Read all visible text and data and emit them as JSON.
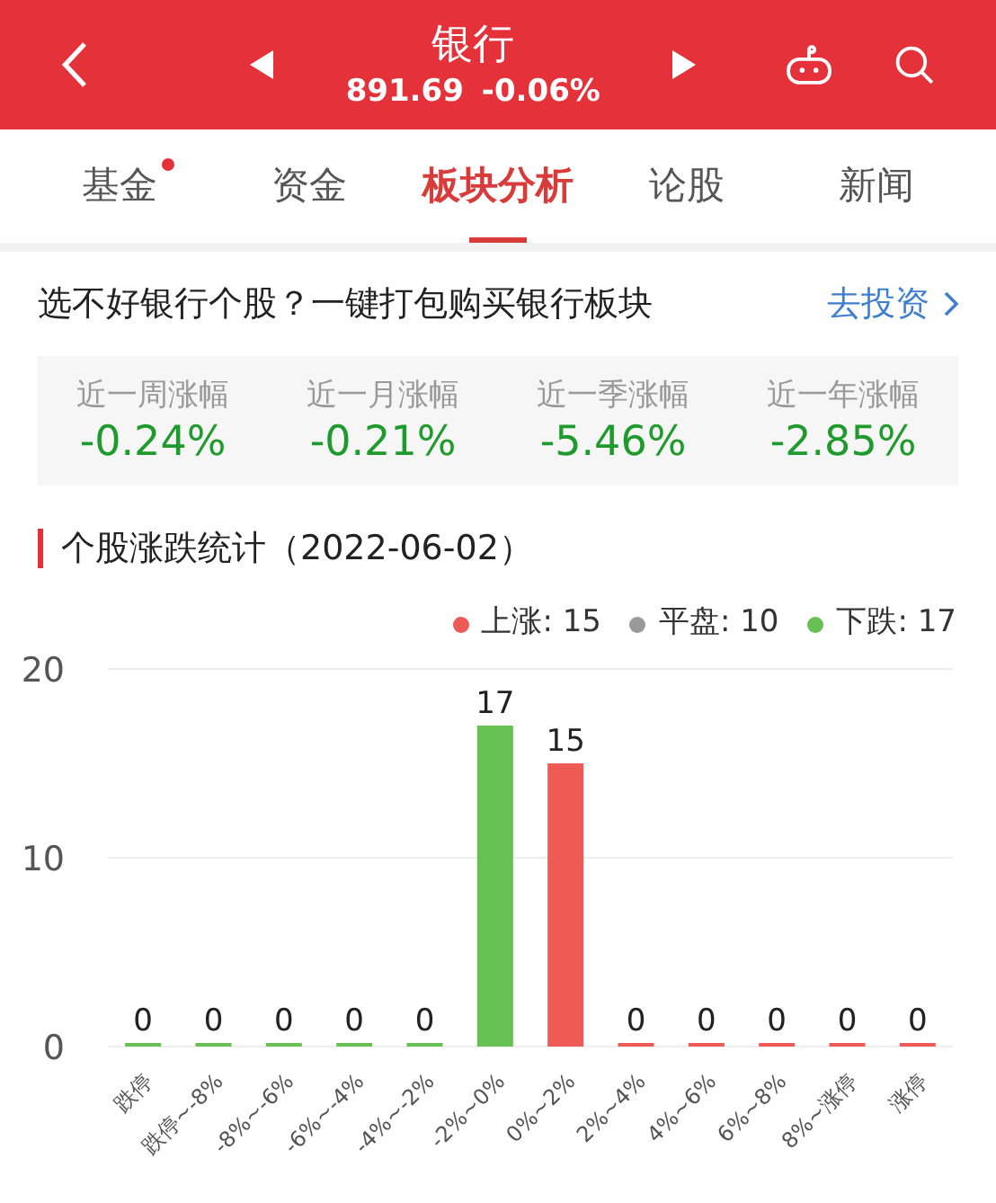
{
  "header": {
    "title": "银行",
    "price": "891.69",
    "change": "-0.06%"
  },
  "tabs": [
    {
      "label": "基金",
      "selected": false,
      "dot": true
    },
    {
      "label": "资金",
      "selected": false,
      "dot": false
    },
    {
      "label": "板块分析",
      "selected": true,
      "dot": false
    },
    {
      "label": "论股",
      "selected": false,
      "dot": false
    },
    {
      "label": "新闻",
      "selected": false,
      "dot": false
    }
  ],
  "promo": {
    "text": "选不好银行个股？一键打包购买银行板块",
    "link": "去投资"
  },
  "returns": [
    {
      "label": "近一周涨幅",
      "value": "-0.24%"
    },
    {
      "label": "近一月涨幅",
      "value": "-0.21%"
    },
    {
      "label": "近一季涨幅",
      "value": "-5.46%"
    },
    {
      "label": "近一年涨幅",
      "value": "-2.85%"
    }
  ],
  "section_title": "个股涨跌统计（2022-06-02）",
  "legend": [
    {
      "label": "上涨: 15",
      "color": "#ee5a55"
    },
    {
      "label": "平盘: 10",
      "color": "#999999"
    },
    {
      "label": "下跌: 17",
      "color": "#66c152"
    }
  ],
  "chart": {
    "chart_data": {
      "type": "bar",
      "stacked": true,
      "data_labels": true,
      "categories": [
        "跌停",
        "跌停~-8%",
        "-8%~-6%",
        "-6%~-4%",
        "-4%~-2%",
        "-2%~0%",
        "0%~2%",
        "2%~4%",
        "4%~6%",
        "6%~8%",
        "8%~涨停",
        "涨停"
      ],
      "series": [
        {
          "color": "#66c152",
          "values": [
            0,
            0,
            0,
            0,
            0,
            17,
            null,
            null,
            null,
            null,
            null,
            null
          ]
        },
        {
          "color": "#ee5a55",
          "values": [
            null,
            null,
            null,
            null,
            null,
            null,
            15,
            0,
            0,
            0,
            0,
            0
          ]
        }
      ],
      "ylim": [
        0,
        20
      ],
      "yticks": [
        0,
        10,
        20
      ]
    }
  }
}
